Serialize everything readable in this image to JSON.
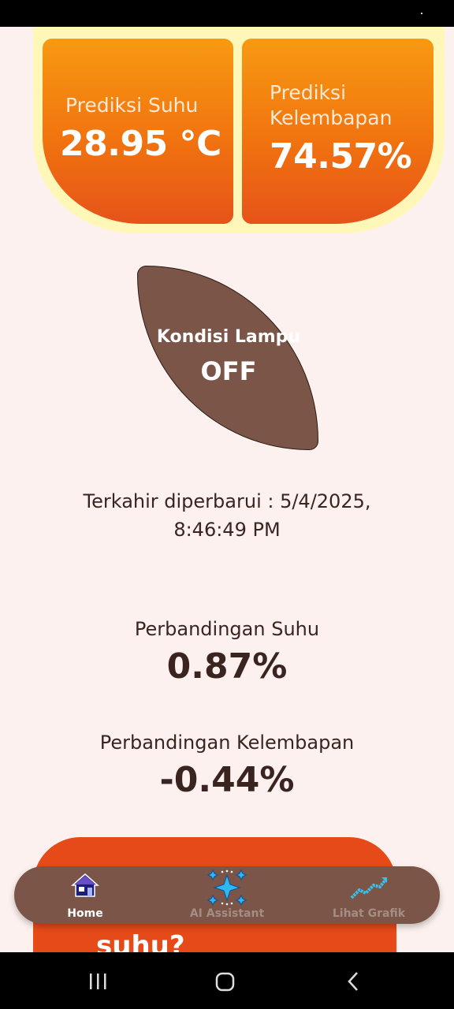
{
  "prediction": {
    "temp_label": "Prediksi Suhu",
    "temp_value": "28.95 °C",
    "humidity_label_line1": "Prediksi",
    "humidity_label_line2": "Kelembapan",
    "humidity_value": "74.57%"
  },
  "lamp": {
    "label": "Kondisi Lampu",
    "status": "OFF"
  },
  "last_updated": {
    "line1": "Terkahir diperbarui : 5/4/2025,",
    "line2": "8:46:49 PM"
  },
  "comparison": {
    "temp_label": "Perbandingan Suhu",
    "temp_value": "0.87%",
    "humidity_label": "Perbandingan Kelembapan",
    "humidity_value": "-0.44%"
  },
  "ask_card": {
    "partial_text": "suhu?"
  },
  "nav": {
    "items": [
      {
        "label": "Home",
        "icon": "home-icon",
        "active": true
      },
      {
        "label": "AI Assistant",
        "icon": "sparkle-icon",
        "active": false
      },
      {
        "label": "Lihat Grafik",
        "icon": "trend-chart-icon",
        "active": false
      }
    ]
  },
  "colors": {
    "background": "#fdf1ef",
    "orange": "#f1730f",
    "brown": "#7a5548",
    "yellow": "#fff7b8",
    "ask_card": "#e64a19"
  }
}
